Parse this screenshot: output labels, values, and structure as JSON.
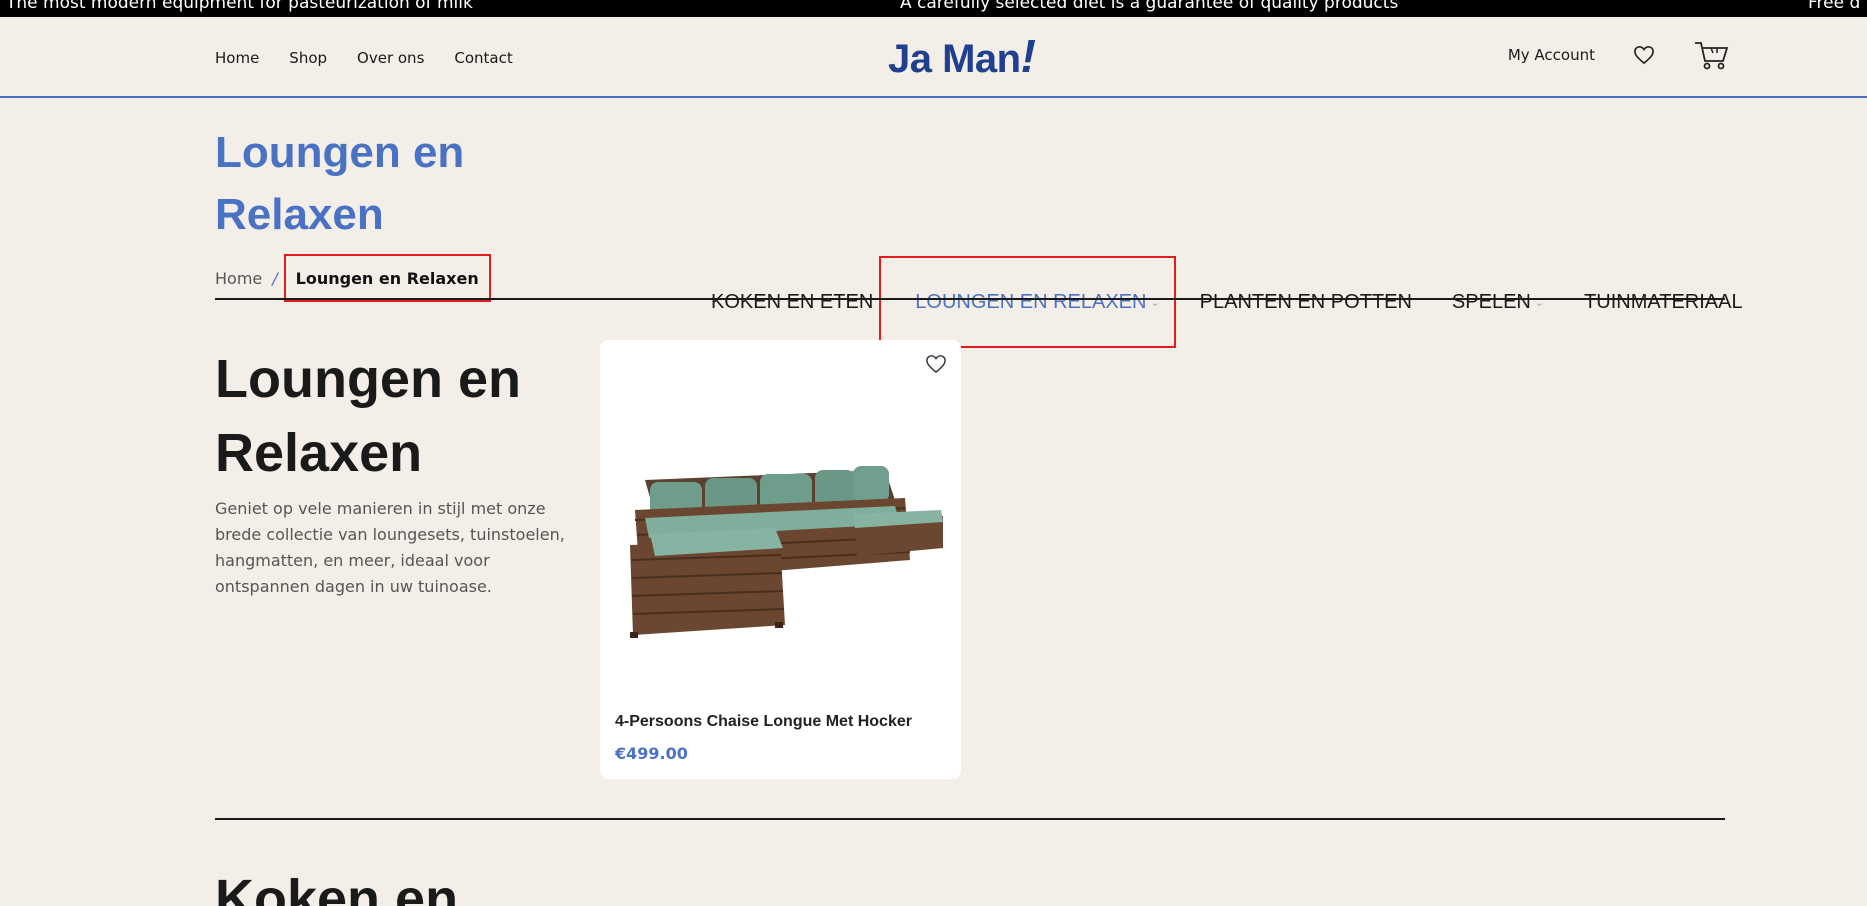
{
  "ticker": {
    "left": "The most modern equipment for pasteurization of milk",
    "center": "A carefully selected diet is a guarantee of quality products",
    "right": "Free d"
  },
  "nav": {
    "home": "Home",
    "shop": "Shop",
    "about": "Over ons",
    "contact": "Contact"
  },
  "logo": {
    "text": "Ja Man",
    "mark": "!"
  },
  "account": {
    "label": "My Account"
  },
  "page": {
    "title": "Loungen en Relaxen"
  },
  "breadcrumb": {
    "home": "Home",
    "separator": "/",
    "current": "Loungen en Relaxen"
  },
  "categories": [
    {
      "label": "KOKEN EN ETEN"
    },
    {
      "label": "LOUNGEN EN RELAXEN",
      "active": true
    },
    {
      "label": "PLANTEN EN POTTEN"
    },
    {
      "label": "SPELEN"
    },
    {
      "label": "TUINMATERIAAL"
    }
  ],
  "section": {
    "title": "Loungen en Relaxen",
    "description": "Geniet op vele manieren in stijl met onze brede collectie van loungesets, tuinstoelen, hangmatten, en meer, ideaal voor ontspannen dagen in uw tuinoase."
  },
  "product": {
    "name": "4-Persoons Chaise Longue Met Hocker",
    "price": "€499.00"
  },
  "next_section": {
    "title": "Koken en"
  },
  "colors": {
    "accent": "#4a72c4",
    "brand": "#1f3f8f",
    "background": "#f3efe8",
    "highlight": "#e01c1c"
  }
}
